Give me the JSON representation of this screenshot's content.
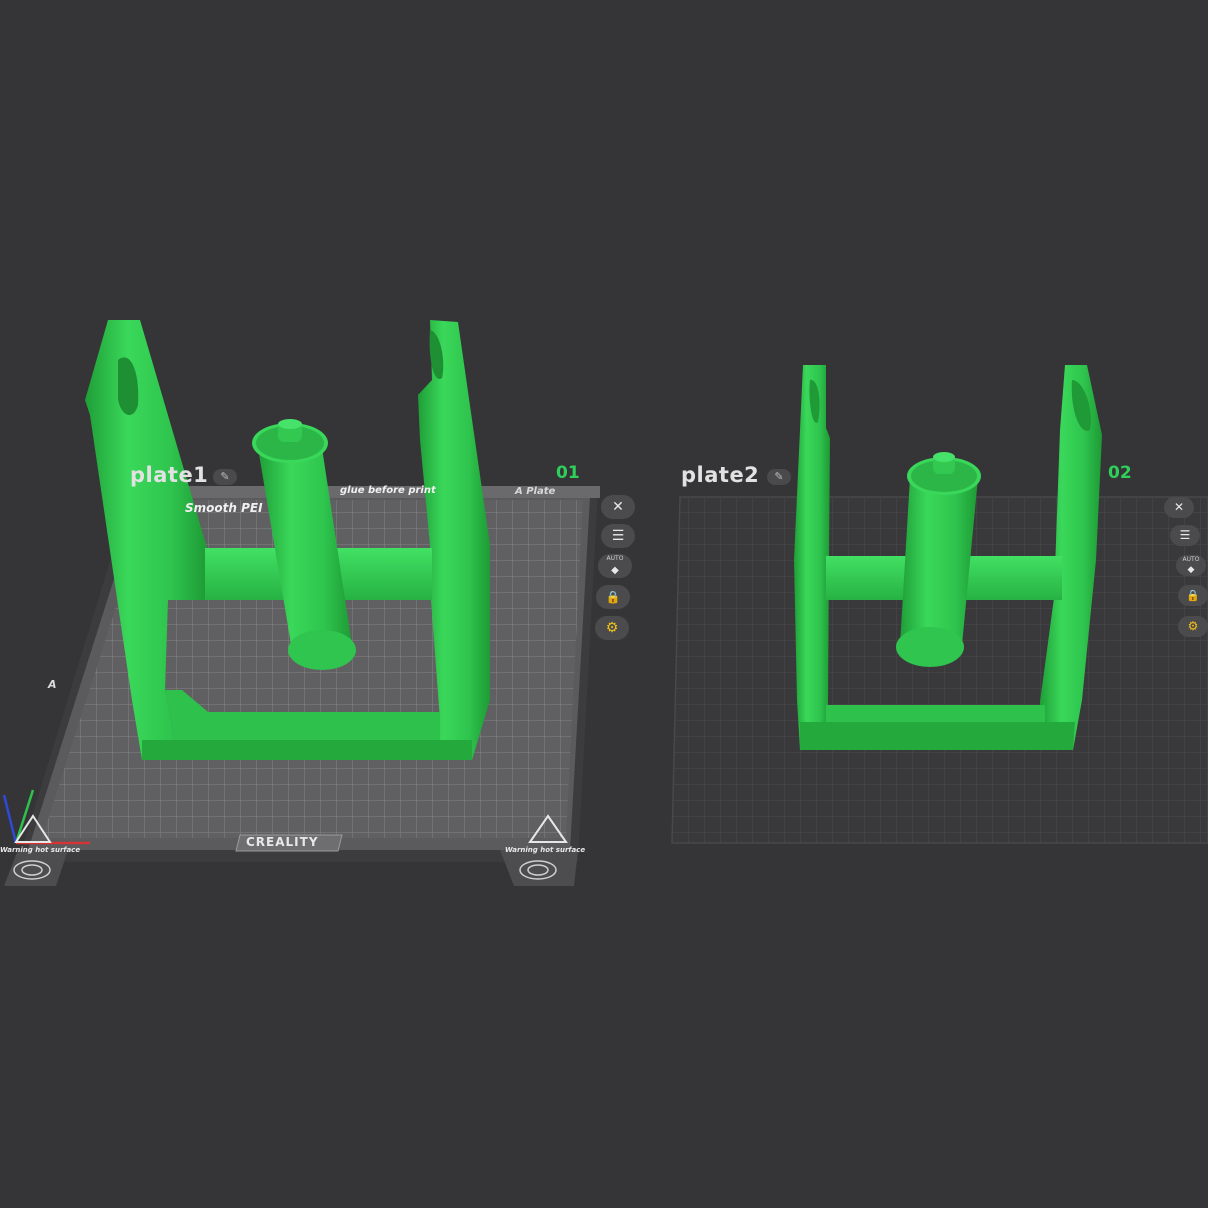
{
  "plates": [
    {
      "name": "plate1",
      "number": "01",
      "bed": {
        "brand": "CREALITY",
        "plate_side_label": "A Plate",
        "surface_text": "Smooth PEI",
        "note": "glue before print",
        "warning_left": "Warning hot surface",
        "warning_right": "Warning hot surface",
        "axis_letter": "A"
      },
      "tools": [
        {
          "name": "close",
          "icon": "close-icon",
          "glyph": "✕"
        },
        {
          "name": "arrange",
          "icon": "list-icon",
          "glyph": "☰"
        },
        {
          "name": "auto-orient",
          "icon": "auto-orient-icon",
          "glyph": "◆",
          "caption": "AUTO"
        },
        {
          "name": "lock",
          "icon": "lock-icon",
          "glyph": "🔒"
        },
        {
          "name": "settings",
          "icon": "gear-icon",
          "glyph": "⚙"
        }
      ]
    },
    {
      "name": "plate2",
      "number": "02",
      "tools": [
        {
          "name": "close",
          "icon": "close-icon",
          "glyph": "✕"
        },
        {
          "name": "arrange",
          "icon": "list-icon",
          "glyph": "☰"
        },
        {
          "name": "auto-orient",
          "icon": "auto-orient-icon",
          "glyph": "◆",
          "caption": "AUTO"
        },
        {
          "name": "lock",
          "icon": "lock-icon",
          "glyph": "🔒"
        },
        {
          "name": "settings",
          "icon": "gear-icon",
          "glyph": "⚙"
        }
      ]
    }
  ],
  "colors": {
    "background": "#353537",
    "model_green": "#34d153",
    "model_green_dark": "#22a83b",
    "plate_number": "#2ed05a",
    "settings_icon": "#f2c21b"
  }
}
